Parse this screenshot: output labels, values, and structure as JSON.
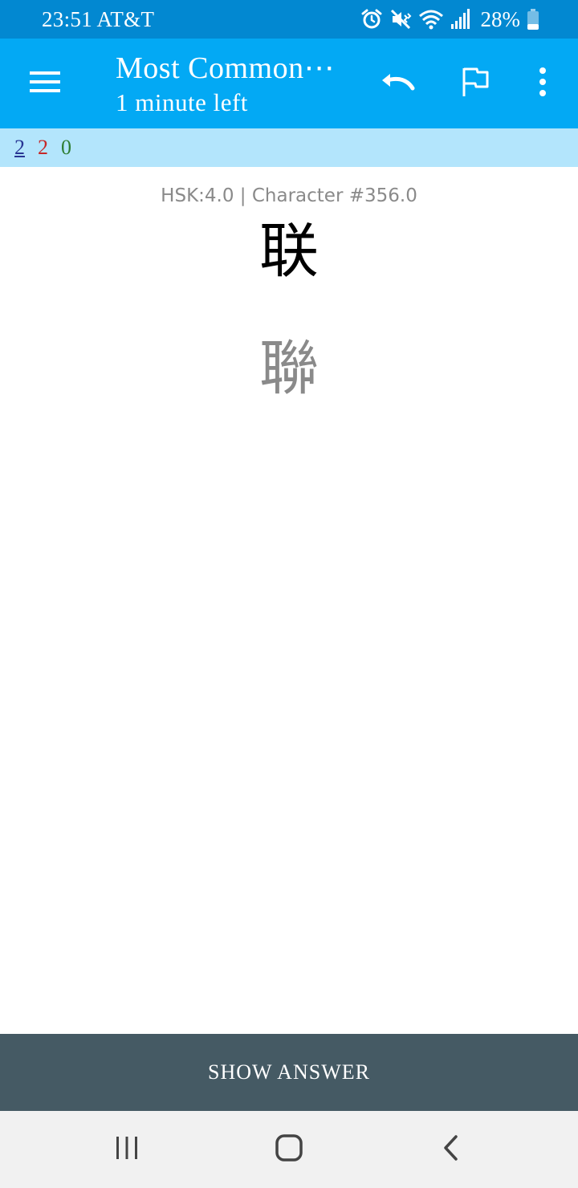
{
  "status_bar": {
    "time_carrier": "23:51 AT&T",
    "battery": "28%",
    "icons": [
      "alarm-icon",
      "mute-vibrate-icon",
      "wifi-icon",
      "signal-icon",
      "battery-icon"
    ]
  },
  "app_bar": {
    "menu_icon": "hamburger-menu-icon",
    "title": "Most Common⋯",
    "subtitle": "1 minute left",
    "undo_icon": "undo-icon",
    "flag_icon": "flag-icon",
    "more_icon": "more-vert-icon"
  },
  "counts": {
    "new": "2",
    "learning": "2",
    "review": "0"
  },
  "card": {
    "info": "HSK:4.0 | Character #356.0",
    "simplified": "联",
    "traditional": "聯"
  },
  "answer_button": {
    "label": "SHOW ANSWER"
  },
  "nav_bar": {
    "icons": [
      "recents-icon",
      "home-icon",
      "back-icon"
    ]
  },
  "colors": {
    "status_bar": "#0288d1",
    "app_bar": "#03a9f4",
    "counts_bar": "#b3e5fc",
    "answer_bar": "#455a64",
    "new_count": "#283593",
    "learning_count": "#c62828",
    "review_count": "#2e7d32"
  }
}
